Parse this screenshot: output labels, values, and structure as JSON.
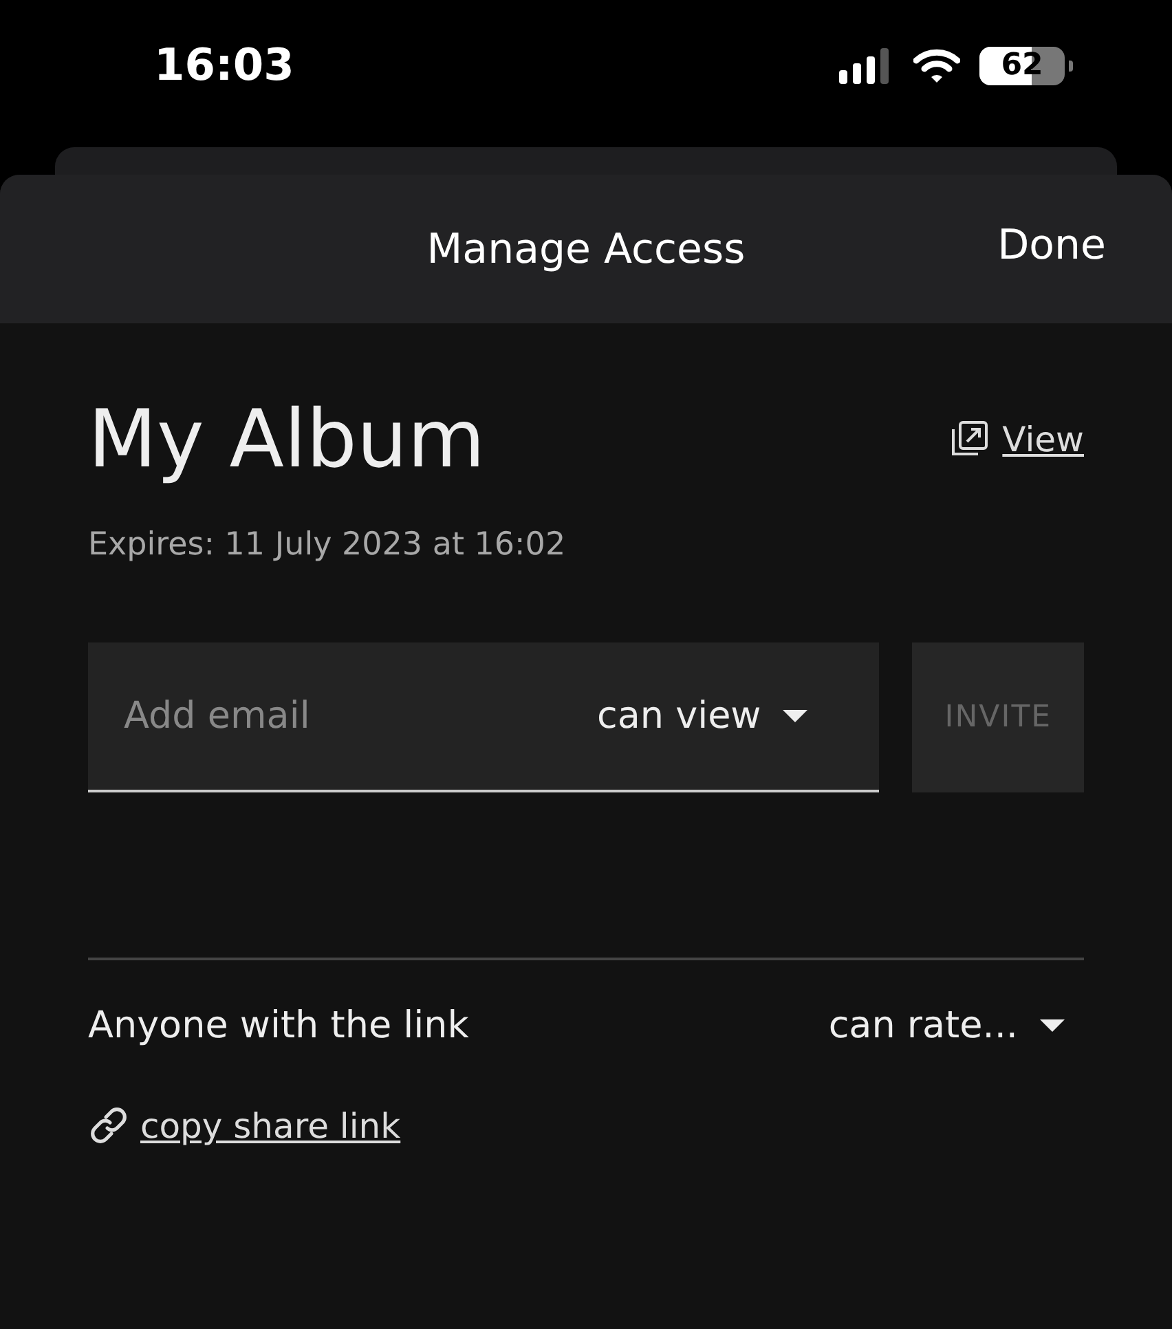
{
  "status_bar": {
    "time": "16:03",
    "battery": "62"
  },
  "header": {
    "title": "Manage Access",
    "done": "Done"
  },
  "album": {
    "title": "My Album",
    "view_link": "View",
    "expires": "Expires: 11 July 2023 at 16:02"
  },
  "invite": {
    "placeholder": "Add email",
    "permission": "can view",
    "button": "INVITE",
    "button_disabled": true
  },
  "link_sharing": {
    "label": "Anyone with the link",
    "permission": "can rate...",
    "copy_link": "copy share link"
  }
}
